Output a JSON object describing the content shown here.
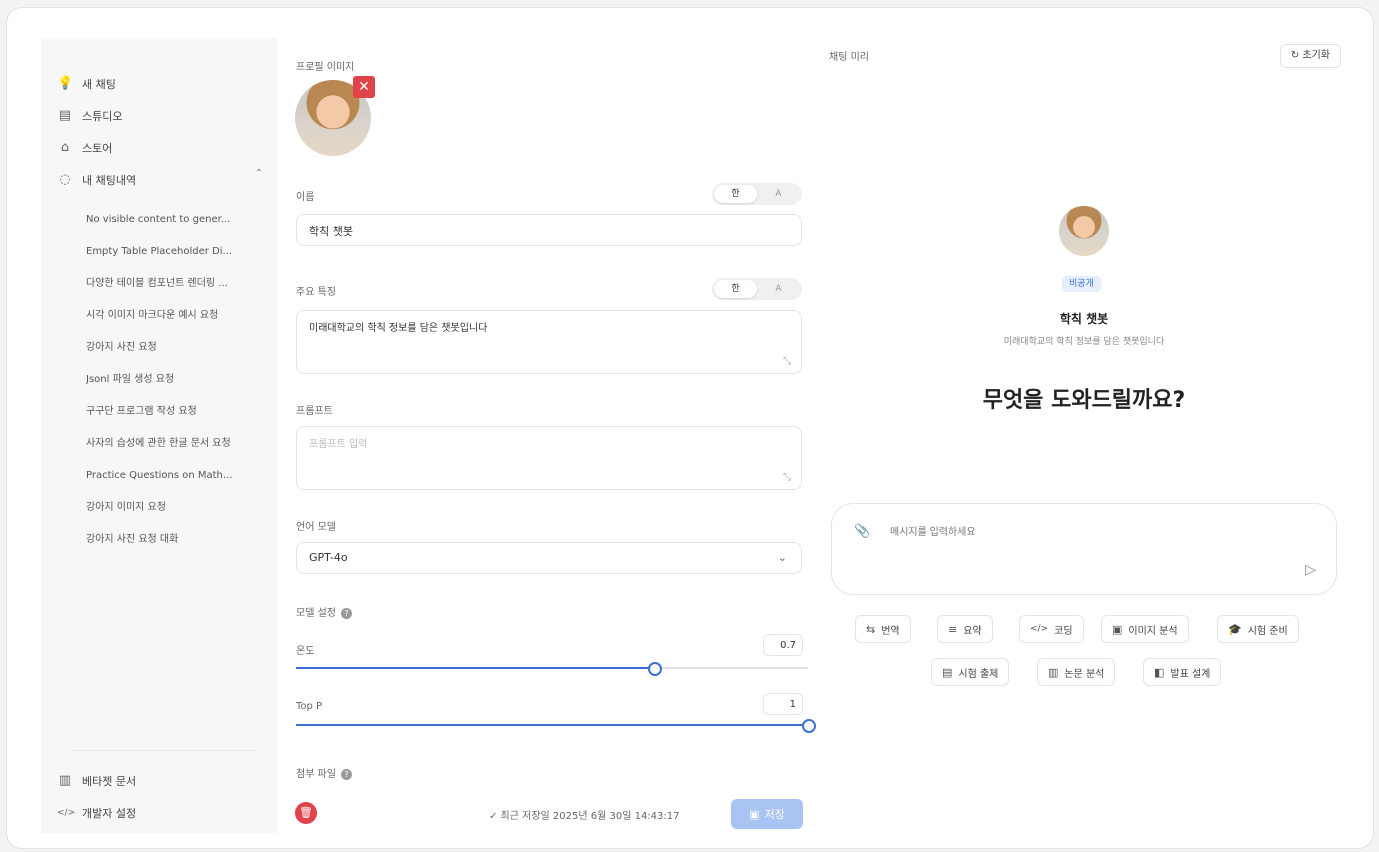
{
  "sidebar": {
    "nav": [
      {
        "icon": "lightbulb-icon",
        "glyph": "💡",
        "label": "새 채팅"
      },
      {
        "icon": "studio-icon",
        "glyph": "▤",
        "label": "스튜디오"
      },
      {
        "icon": "store-icon",
        "glyph": "⌂",
        "label": "스토어"
      },
      {
        "icon": "chat-history-icon",
        "glyph": "◌",
        "label": "내 채팅내역"
      }
    ],
    "history": [
      "No visible content to gener...",
      "Empty Table Placeholder Di...",
      "다양한 테이블 컴포넌트 렌더링 ...",
      "시각 이미지 마크다운 예시 요청",
      "강아지 사진 요청",
      "Jsonl 파일 생성 요청",
      "구구단 프로그램 작성 요청",
      "사자의 습성에 관한 한글 문서 요청",
      "Practice Questions on Math...",
      "강아지 이미지 요청",
      "강아지 사진 요청 대화"
    ],
    "bottom": [
      {
        "icon": "book-icon",
        "glyph": "▥",
        "label": "베타젯 문서"
      },
      {
        "icon": "code-icon",
        "glyph": "</>",
        "label": "개발자 설정"
      }
    ]
  },
  "editor": {
    "profile_label": "프로필 이미지",
    "name_label": "이름",
    "name_value": "학칙 챗봇",
    "lang_options": [
      "한",
      "A"
    ],
    "desc_label": "주요 특징",
    "desc_value": "미래대학교의 학칙 정보를 담은 챗봇입니다",
    "prompt_label": "프롬프트",
    "prompt_placeholder": "프롬프트 입력",
    "model_label": "언어 모델",
    "model_value": "GPT-4o",
    "model_settings_label": "모델 설정",
    "temperature_label": "온도",
    "temperature_value": "0.7",
    "temperature_fraction": 0.7,
    "top_p_label": "Top P",
    "top_p_value": "1",
    "top_p_fraction": 1.0,
    "attachments_label": "첨부 파일",
    "saved_status": "✓ 최근 저장일 2025년 6월 30일 14:43:17",
    "save_label": "저장"
  },
  "preview": {
    "title": "채팅 미리",
    "reset_label": "초기화",
    "badge": "비공개",
    "bot_name": "학칙 챗봇",
    "bot_desc": "미래대학교의 학칙 정보를 담은 챗봇입니다",
    "greeting": "무엇을 도와드릴까요?",
    "input_placeholder": "메시지를 입력하세요",
    "chips_row1": [
      {
        "icon": "translate-icon",
        "glyph": "⇆",
        "label": "번역"
      },
      {
        "icon": "summary-icon",
        "glyph": "≡",
        "label": "요약"
      },
      {
        "icon": "code-icon",
        "glyph": "</>",
        "label": "코딩"
      },
      {
        "icon": "image-icon",
        "glyph": "▣",
        "label": "이미지 분석"
      },
      {
        "icon": "graduation-icon",
        "glyph": "🎓",
        "label": "시험 준비"
      }
    ],
    "chips_row2": [
      {
        "icon": "exam-icon",
        "glyph": "▤",
        "label": "시험 출제"
      },
      {
        "icon": "paper-icon",
        "glyph": "▥",
        "label": "논문 분석"
      },
      {
        "icon": "presentation-icon",
        "glyph": "◧",
        "label": "발표 설계"
      }
    ]
  },
  "colors": {
    "accent": "#3d6fd6",
    "danger": "#e0434a",
    "save_disabled": "#a9c3f2"
  }
}
